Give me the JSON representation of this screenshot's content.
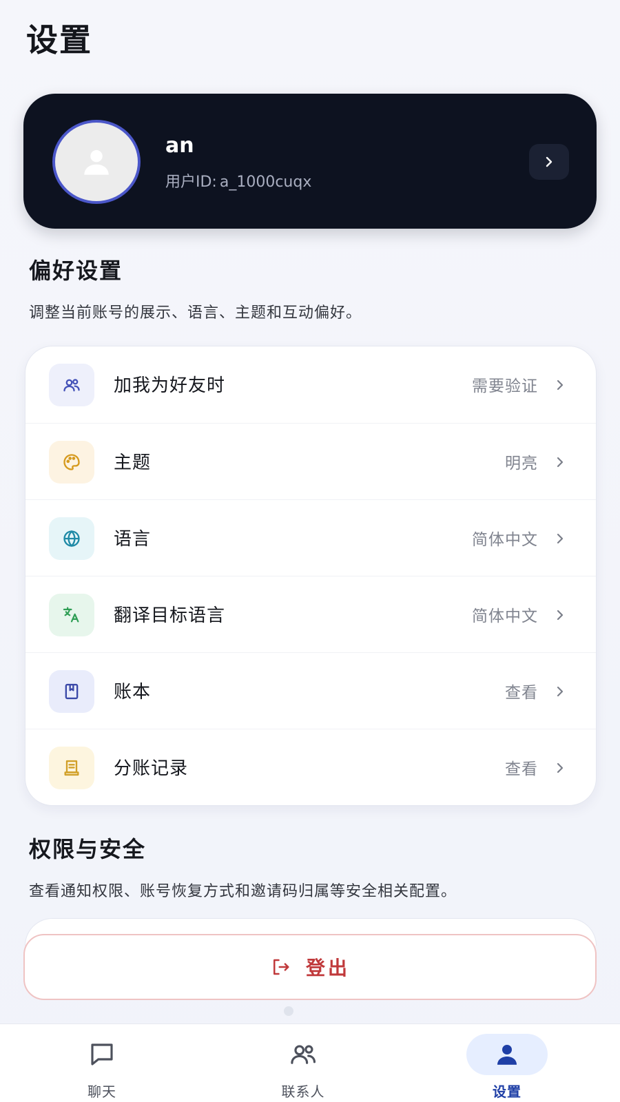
{
  "page": {
    "title": "设置"
  },
  "profile": {
    "name": "an",
    "id_label": "用户ID:",
    "id_value": "a_1000cuqx"
  },
  "preferences": {
    "title": "偏好设置",
    "description": "调整当前账号的展示、语言、主题和互动偏好。",
    "items": [
      {
        "label": "加我为好友时",
        "value": "需要验证",
        "icon": "users-icon",
        "color": "#4452b8",
        "bg": "#eef0fb"
      },
      {
        "label": "主题",
        "value": "明亮",
        "icon": "palette-icon",
        "color": "#d69a1e",
        "bg": "#fdf3e2"
      },
      {
        "label": "语言",
        "value": "简体中文",
        "icon": "globe-icon",
        "color": "#1f8aa6",
        "bg": "#e6f5f8"
      },
      {
        "label": "翻译目标语言",
        "value": "简体中文",
        "icon": "translate-icon",
        "color": "#2f9e55",
        "bg": "#e7f6ec"
      },
      {
        "label": "账本",
        "value": "查看",
        "icon": "book-icon",
        "color": "#3a48a8",
        "bg": "#e9ecfb"
      },
      {
        "label": "分账记录",
        "value": "查看",
        "icon": "receipt-icon",
        "color": "#d1a028",
        "bg": "#fdf5df"
      }
    ]
  },
  "security": {
    "title": "权限与安全",
    "description": "查看通知权限、账号恢复方式和邀请码归属等安全相关配置。"
  },
  "logout": {
    "label": "登出",
    "color": "#c0393b"
  },
  "nav": {
    "items": [
      {
        "label": "聊天",
        "icon": "chat-icon",
        "active": false
      },
      {
        "label": "联系人",
        "icon": "contacts-icon",
        "active": false
      },
      {
        "label": "设置",
        "icon": "person-icon",
        "active": true
      }
    ]
  }
}
